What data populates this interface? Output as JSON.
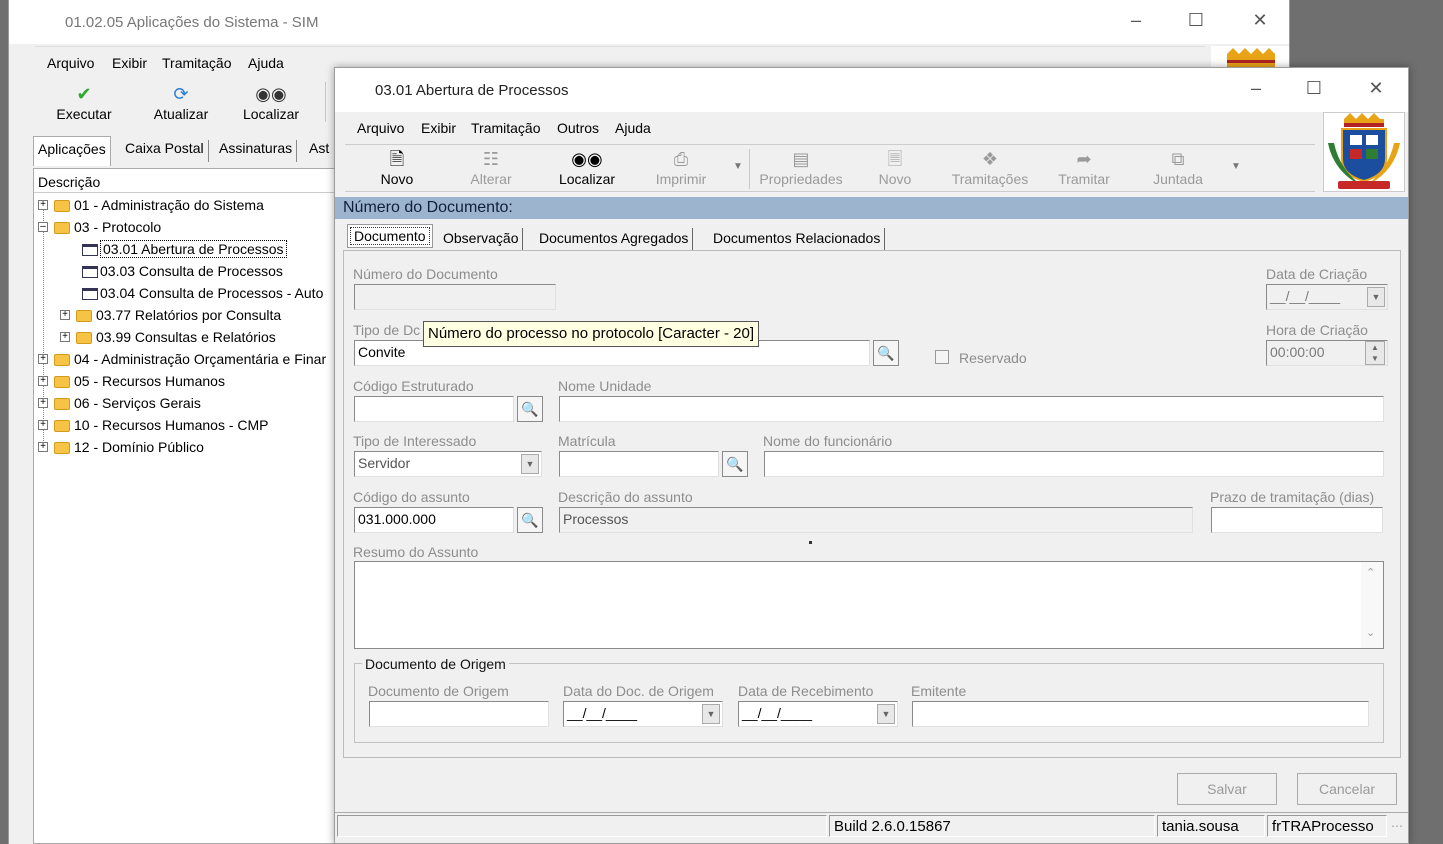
{
  "main_window": {
    "title": "01.02.05 Aplicações do Sistema - SIM",
    "menu": [
      {
        "label": "Arquivo",
        "accel": "A",
        "rest": "rquivo"
      },
      {
        "label": "Exibir",
        "accel": "x",
        "pre": "E",
        "rest": "ibir"
      },
      {
        "label": "Tramitação"
      },
      {
        "label": "Ajuda",
        "pre": "A",
        "accel": "j",
        "rest": "uda"
      }
    ],
    "toolbar": {
      "execute": "Executar",
      "refresh": "Atualizar",
      "find": "Localizar"
    },
    "tabs": [
      "Aplicações",
      "Caixa Postal",
      "Assinaturas",
      "Ast"
    ],
    "tree_header": "Descrição",
    "tree": [
      {
        "label": "01 - Administração do Sistema",
        "type": "folder",
        "expanded": false
      },
      {
        "label": "03 - Protocolo",
        "type": "folder",
        "expanded": true
      },
      {
        "label": "03.01 Abertura de Processos",
        "type": "window",
        "selected": true
      },
      {
        "label": "03.03 Consulta de Processos",
        "type": "window"
      },
      {
        "label": "03.04 Consulta de Processos - Auto",
        "type": "window"
      },
      {
        "label": "03.77 Relatórios por Consulta",
        "type": "folder",
        "expanded": false
      },
      {
        "label": "03.99 Consultas e Relatórios",
        "type": "folder",
        "expanded": false
      },
      {
        "label": "04 - Administração Orçamentária e Finar",
        "type": "folder",
        "expanded": false
      },
      {
        "label": "05 - Recursos Humanos",
        "type": "folder",
        "expanded": false
      },
      {
        "label": "06 - Serviços Gerais",
        "type": "folder",
        "expanded": false
      },
      {
        "label": "10 - Recursos Humanos - CMP",
        "type": "folder",
        "expanded": false
      },
      {
        "label": "12 - Domínio Público",
        "type": "folder",
        "expanded": false
      }
    ]
  },
  "dialog": {
    "title": "03.01 Abertura de Processos",
    "menu": [
      "Arquivo",
      "Exibir",
      "Tramitação",
      "Outros",
      "Ajuda"
    ],
    "toolbar": {
      "novo": "Novo",
      "alterar": "Alterar",
      "localizar": "Localizar",
      "imprimir": "Imprimir",
      "propriedades": "Propriedades",
      "novo2": "Novo",
      "tramitacoes": "Tramitações",
      "tramitar": "Tramitar",
      "juntada": "Juntada"
    },
    "header_bar": "Número do Documento:",
    "tabs": [
      "Documento",
      "Observação",
      "Documentos Agregados",
      "Documentos Relacionados"
    ],
    "form": {
      "numero_documento_label": "Número do Documento",
      "numero_documento_value": "",
      "data_criacao_label": "Data de Criação",
      "data_criacao_value": "__/__/____",
      "tipo_documento_label": "Tipo de Dc",
      "tipo_documento_value": "Convite",
      "reservado_label": "Reservado",
      "hora_criacao_label": "Hora de Criação",
      "hora_criacao_value": "00:00:00",
      "codigo_estruturado_label": "Código Estruturado",
      "codigo_estruturado_value": "",
      "nome_unidade_label": "Nome Unidade",
      "nome_unidade_value": "",
      "tipo_interessado_label": "Tipo de Interessado",
      "tipo_interessado_value": "Servidor",
      "matricula_label": "Matrícula",
      "matricula_value": "",
      "nome_funcionario_label": "Nome do funcionário",
      "nome_funcionario_value": "",
      "codigo_assunto_label": "Código do assunto",
      "codigo_assunto_value": "031.000.000",
      "descricao_assunto_label": "Descrição do assunto",
      "descricao_assunto_value": "Processos",
      "prazo_label": "Prazo de tramitação (dias)",
      "prazo_value": "",
      "resumo_label": "Resumo do Assunto",
      "resumo_value": "",
      "origem_group_label": "Documento de Origem",
      "doc_origem_label": "Documento de Origem",
      "doc_origem_value": "",
      "data_doc_origem_label": "Data do Doc. de Origem",
      "data_doc_origem_value": "__/__/____",
      "data_recebimento_label": "Data de Recebimento",
      "data_recebimento_value": "__/__/____",
      "emitente_label": "Emitente",
      "emitente_value": ""
    },
    "tooltip": "Número do processo no protocolo [Caracter - 20]",
    "buttons": {
      "save": "Salvar",
      "cancel": "Cancelar"
    },
    "status": {
      "build": "Build 2.6.0.15867",
      "user": "tania.sousa",
      "form": "frTRAProcesso"
    }
  }
}
